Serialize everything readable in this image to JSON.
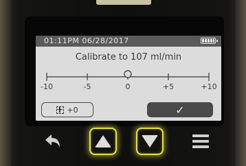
{
  "status": {
    "datetime": "01:11PM 06/28/2017",
    "battery_icon": "battery-full-icon"
  },
  "screen": {
    "title": "Calibrate to 107 ml/min",
    "scale": {
      "labels": [
        "-10",
        "-5",
        "0",
        "+5",
        "+10"
      ],
      "value": 0
    },
    "zero_button": {
      "icon": "zero-offset-icon",
      "label": "+0"
    },
    "confirm_button": {
      "label": "✓"
    }
  },
  "hardware_keys": [
    "back-arrow-icon",
    "up-triangle-icon",
    "down-triangle-icon",
    "menu-icon"
  ],
  "colors": {
    "key_highlight": "#e8e04a",
    "screen_bg": "#dcdcdc",
    "status_bar": "#5a5a5a",
    "button_dark": "#4a4a4a"
  }
}
